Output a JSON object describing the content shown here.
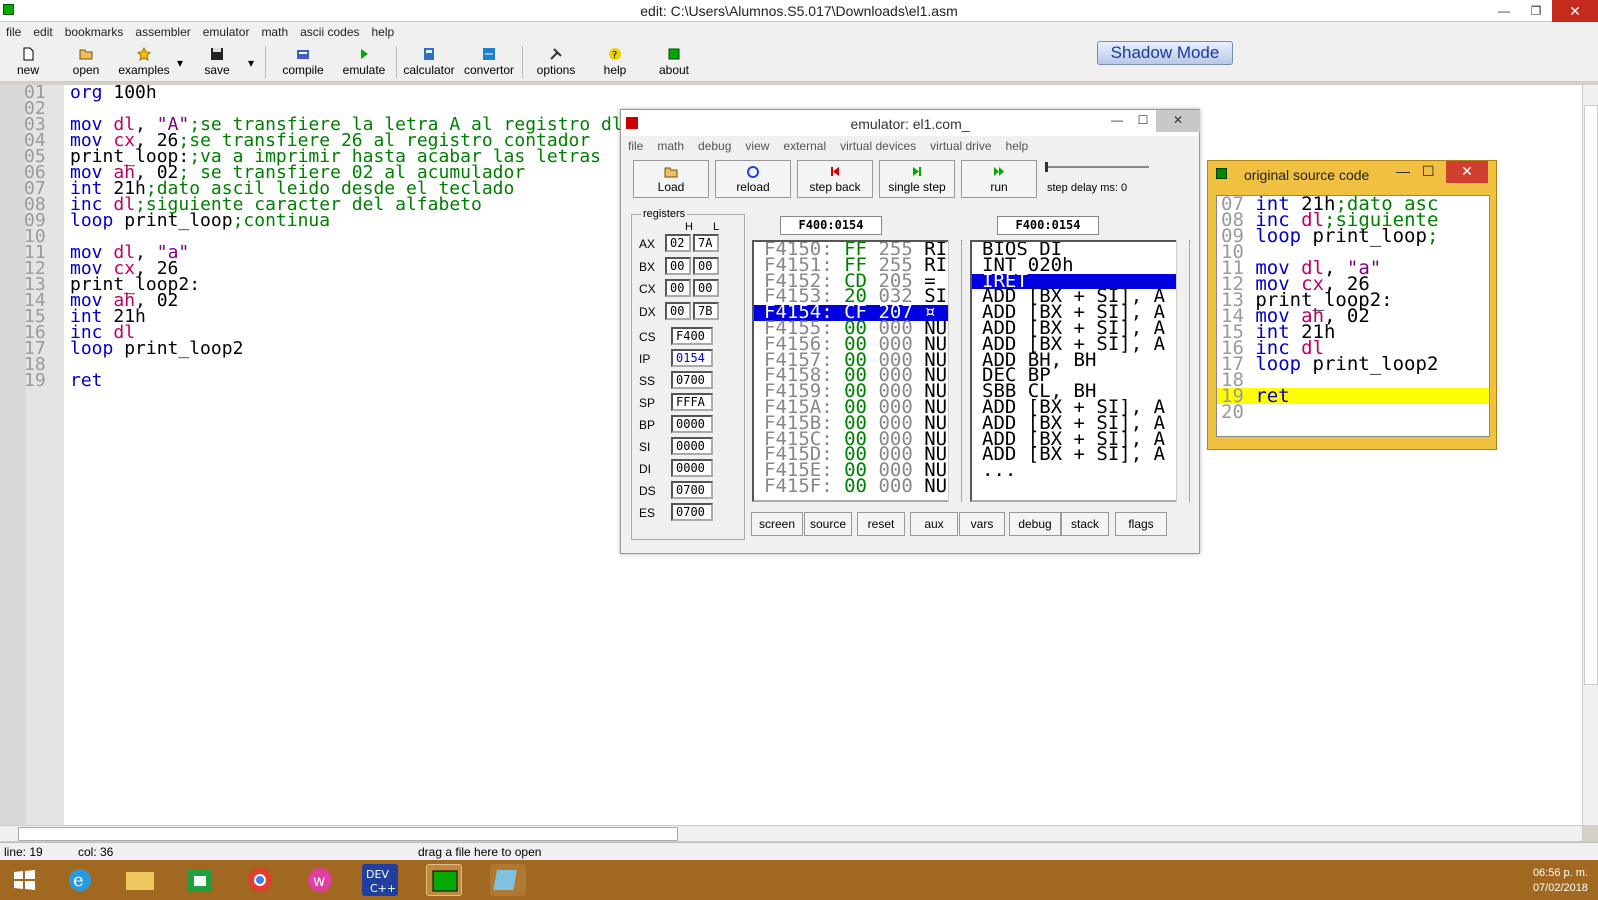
{
  "window": {
    "title": "edit: C:\\Users\\Alumnos.S5.017\\Downloads\\el1.asm"
  },
  "menu": [
    "file",
    "edit",
    "bookmarks",
    "assembler",
    "emulator",
    "math",
    "ascii codes",
    "help"
  ],
  "toolbar": {
    "new": "new",
    "open": "open",
    "examples": "examples",
    "save": "save",
    "compile": "compile",
    "emulate": "emulate",
    "calculator": "calculator",
    "convertor": "convertor",
    "options": "options",
    "help": "help",
    "about": "about",
    "shadow_mode": "Shadow Mode"
  },
  "code_lines": [
    {
      "n": "01",
      "parts": [
        [
          "kw",
          "org"
        ],
        [
          "tx",
          " 100h"
        ]
      ]
    },
    {
      "n": "02",
      "parts": []
    },
    {
      "n": "03",
      "parts": [
        [
          "kw",
          "mov"
        ],
        [
          "tx",
          " "
        ],
        [
          "rg",
          "dl"
        ],
        [
          "tx",
          ", "
        ],
        [
          "st",
          "\"A\""
        ],
        [
          "cm",
          ";se transfiere la letra A al registro dl"
        ]
      ]
    },
    {
      "n": "04",
      "parts": [
        [
          "kw",
          "mov"
        ],
        [
          "tx",
          " "
        ],
        [
          "rg",
          "cx"
        ],
        [
          "tx",
          ", 26"
        ],
        [
          "cm",
          ";se transfiere 26 al registro contador"
        ]
      ]
    },
    {
      "n": "05",
      "parts": [
        [
          "tx",
          "print_loop:"
        ],
        [
          "cm",
          ";va a imprimir hasta acabar las letras"
        ]
      ]
    },
    {
      "n": "06",
      "parts": [
        [
          "kw",
          "mov"
        ],
        [
          "tx",
          " "
        ],
        [
          "rg",
          "ah"
        ],
        [
          "tx",
          ", 02"
        ],
        [
          "cm",
          "; se transfiere 02 al acumulador"
        ]
      ]
    },
    {
      "n": "07",
      "parts": [
        [
          "kw",
          "int"
        ],
        [
          "tx",
          " 21h"
        ],
        [
          "cm",
          ";dato ascil leido desde el teclado"
        ]
      ]
    },
    {
      "n": "08",
      "parts": [
        [
          "kw",
          "inc"
        ],
        [
          "tx",
          " "
        ],
        [
          "rg",
          "dl"
        ],
        [
          "cm",
          ";siguiente caracter del alfabeto"
        ]
      ]
    },
    {
      "n": "09",
      "parts": [
        [
          "kw",
          "loop"
        ],
        [
          "tx",
          " print_loop"
        ],
        [
          "cm",
          ";continua"
        ]
      ]
    },
    {
      "n": "10",
      "parts": []
    },
    {
      "n": "11",
      "parts": [
        [
          "kw",
          "mov"
        ],
        [
          "tx",
          " "
        ],
        [
          "rg",
          "dl"
        ],
        [
          "tx",
          ", "
        ],
        [
          "st",
          "\"a\""
        ]
      ]
    },
    {
      "n": "12",
      "parts": [
        [
          "kw",
          "mov"
        ],
        [
          "tx",
          " "
        ],
        [
          "rg",
          "cx"
        ],
        [
          "tx",
          ", 26"
        ]
      ]
    },
    {
      "n": "13",
      "parts": [
        [
          "tx",
          "print_loop2:"
        ]
      ]
    },
    {
      "n": "14",
      "parts": [
        [
          "kw",
          "mov"
        ],
        [
          "tx",
          " "
        ],
        [
          "rg",
          "ah"
        ],
        [
          "tx",
          ", 02"
        ]
      ]
    },
    {
      "n": "15",
      "parts": [
        [
          "kw",
          "int"
        ],
        [
          "tx",
          " 21h"
        ]
      ]
    },
    {
      "n": "16",
      "parts": [
        [
          "kw",
          "inc"
        ],
        [
          "tx",
          " "
        ],
        [
          "rg",
          "dl"
        ]
      ]
    },
    {
      "n": "17",
      "parts": [
        [
          "kw",
          "loop"
        ],
        [
          "tx",
          " print_loop2"
        ]
      ]
    },
    {
      "n": "18",
      "parts": []
    },
    {
      "n": "19",
      "parts": [
        [
          "kw",
          "ret"
        ]
      ]
    }
  ],
  "status": {
    "line": "line: 19",
    "col": "col: 36",
    "drag": "drag a file here to open"
  },
  "emulator": {
    "title": "emulator: el1.com_",
    "menu": [
      "file",
      "math",
      "debug",
      "view",
      "external",
      "virtual devices",
      "virtual drive",
      "help"
    ],
    "buttons": {
      "load": "Load",
      "reload": "reload",
      "step_back": "step back",
      "single_step": "single step",
      "run": "run"
    },
    "step_delay": "step delay ms: 0",
    "registers_label": "registers",
    "h": "H",
    "l": "L",
    "regs": [
      {
        "name": "AX",
        "h": "02",
        "l": "7A"
      },
      {
        "name": "BX",
        "h": "00",
        "l": "00"
      },
      {
        "name": "CX",
        "h": "00",
        "l": "00"
      },
      {
        "name": "DX",
        "h": "00",
        "l": "7B"
      }
    ],
    "seg": [
      {
        "name": "CS",
        "v": "F400"
      },
      {
        "name": "IP",
        "v": "0154"
      },
      {
        "name": "SS",
        "v": "0700"
      },
      {
        "name": "SP",
        "v": "FFFA"
      },
      {
        "name": "BP",
        "v": "0000"
      },
      {
        "name": "SI",
        "v": "0000"
      },
      {
        "name": "DI",
        "v": "0000"
      },
      {
        "name": "DS",
        "v": "0700"
      },
      {
        "name": "ES",
        "v": "0700"
      }
    ],
    "addr_left": "F400:0154",
    "addr_right": "F400:0154",
    "memory": [
      {
        "a": "F4150:",
        "h": "FF",
        "d": "255",
        "c": "RI"
      },
      {
        "a": "F4151:",
        "h": "FF",
        "d": "255",
        "c": "RI"
      },
      {
        "a": "F4152:",
        "h": "CD",
        "d": "205",
        "c": "="
      },
      {
        "a": "F4153:",
        "h": "20",
        "d": "032",
        "c": "SI"
      },
      {
        "a": "F4154:",
        "h": "CF",
        "d": "207",
        "c": "¤"
      },
      {
        "a": "F4155:",
        "h": "00",
        "d": "000",
        "c": "NU"
      },
      {
        "a": "F4156:",
        "h": "00",
        "d": "000",
        "c": "NU"
      },
      {
        "a": "F4157:",
        "h": "00",
        "d": "000",
        "c": "NU"
      },
      {
        "a": "F4158:",
        "h": "00",
        "d": "000",
        "c": "NU"
      },
      {
        "a": "F4159:",
        "h": "00",
        "d": "000",
        "c": "NU"
      },
      {
        "a": "F415A:",
        "h": "00",
        "d": "000",
        "c": "NU"
      },
      {
        "a": "F415B:",
        "h": "00",
        "d": "000",
        "c": "NU"
      },
      {
        "a": "F415C:",
        "h": "00",
        "d": "000",
        "c": "NU"
      },
      {
        "a": "F415D:",
        "h": "00",
        "d": "000",
        "c": "NU"
      },
      {
        "a": "F415E:",
        "h": "00",
        "d": "000",
        "c": "NU"
      },
      {
        "a": "F415F:",
        "h": "00",
        "d": "000",
        "c": "NU"
      }
    ],
    "disasm": [
      "BIOS DI",
      "INT 020h",
      "IRET",
      "ADD [BX + SI], A",
      "ADD [BX + SI], A",
      "ADD [BX + SI], A",
      "ADD [BX + SI], A",
      "ADD BH, BH",
      "DEC BP",
      "SBB CL, BH",
      "ADD [BX + SI], A",
      "ADD [BX + SI], A",
      "ADD [BX + SI], A",
      "ADD [BX + SI], A",
      "..."
    ],
    "bottom": [
      "screen",
      "source",
      "reset",
      "aux",
      "vars",
      "debug",
      "stack",
      "flags"
    ]
  },
  "source_window": {
    "title": "original source code",
    "lines": [
      {
        "n": "07",
        "parts": [
          [
            "kw",
            "int"
          ],
          [
            "tx",
            " 21h"
          ],
          [
            "cm",
            ";dato asc"
          ]
        ]
      },
      {
        "n": "08",
        "parts": [
          [
            "kw",
            "inc"
          ],
          [
            "tx",
            " "
          ],
          [
            "rg",
            "dl"
          ],
          [
            "cm",
            ";siguiente"
          ]
        ]
      },
      {
        "n": "09",
        "parts": [
          [
            "kw",
            "loop"
          ],
          [
            "tx",
            " print_loop"
          ],
          [
            "cm",
            ";"
          ]
        ]
      },
      {
        "n": "10",
        "parts": []
      },
      {
        "n": "11",
        "parts": [
          [
            "kw",
            "mov"
          ],
          [
            "tx",
            " "
          ],
          [
            "rg",
            "dl"
          ],
          [
            "tx",
            ", "
          ],
          [
            "st",
            "\"a\""
          ]
        ]
      },
      {
        "n": "12",
        "parts": [
          [
            "kw",
            "mov"
          ],
          [
            "tx",
            " "
          ],
          [
            "rg",
            "cx"
          ],
          [
            "tx",
            ", 26"
          ]
        ]
      },
      {
        "n": "13",
        "parts": [
          [
            "tx",
            "print_loop2:"
          ]
        ]
      },
      {
        "n": "14",
        "parts": [
          [
            "kw",
            "mov"
          ],
          [
            "tx",
            " "
          ],
          [
            "rg",
            "ah"
          ],
          [
            "tx",
            ", 02"
          ]
        ]
      },
      {
        "n": "15",
        "parts": [
          [
            "kw",
            "int"
          ],
          [
            "tx",
            " 21h"
          ]
        ]
      },
      {
        "n": "16",
        "parts": [
          [
            "kw",
            "inc"
          ],
          [
            "tx",
            " "
          ],
          [
            "rg",
            "dl"
          ]
        ]
      },
      {
        "n": "17",
        "parts": [
          [
            "kw",
            "loop"
          ],
          [
            "tx",
            " print_loop2"
          ]
        ]
      },
      {
        "n": "18",
        "parts": []
      },
      {
        "n": "19",
        "parts": [
          [
            "kw",
            "ret"
          ]
        ]
      },
      {
        "n": "20",
        "parts": []
      }
    ]
  },
  "clock": {
    "time": "06:56 p. m.",
    "date": "07/02/2018"
  },
  "colors": {
    "accent": "#0000e0",
    "taskbar": "#a06820",
    "source_bg": "#f0c040"
  }
}
